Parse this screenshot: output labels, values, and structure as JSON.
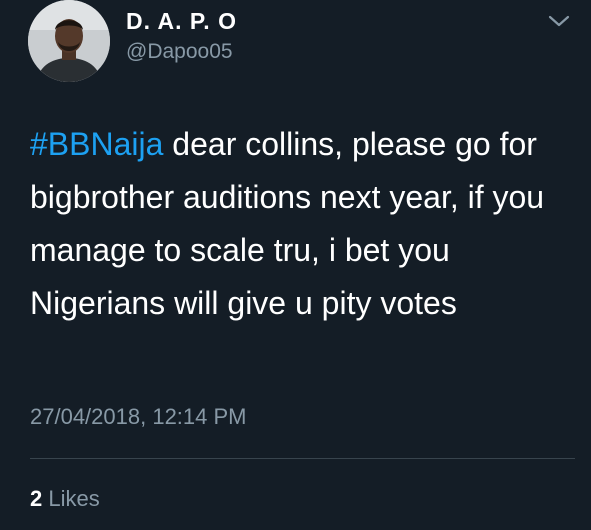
{
  "tweet": {
    "display_name": "D. A. P. O",
    "handle": "@Dapoo05",
    "hashtag": "#BBNaija",
    "text": " dear collins, please go for bigbrother auditions next year, if you manage to scale tru, i bet you Nigerians will give u pity votes",
    "timestamp": "27/04/2018, 12:14 PM",
    "likes_count": "2",
    "likes_label": "Likes"
  },
  "icons": {
    "menu": "chevron-down-icon",
    "avatar": "avatar"
  },
  "colors": {
    "background": "#141d26",
    "hashtag": "#1da1f2",
    "secondary_text": "#8899a6",
    "divider": "#38444d"
  }
}
